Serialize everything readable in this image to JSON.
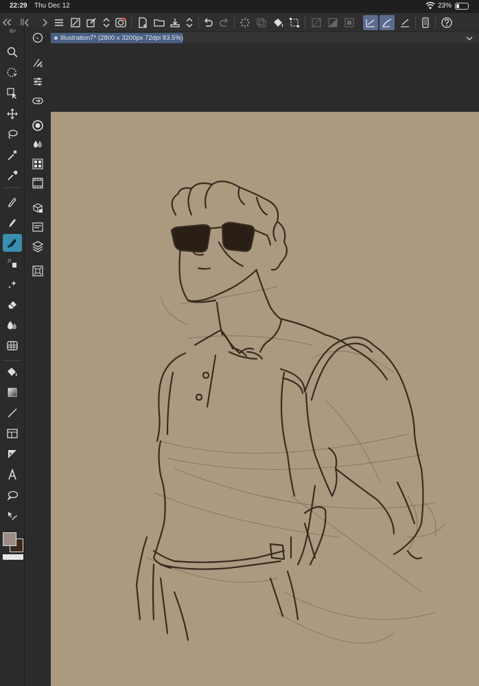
{
  "status_bar": {
    "time": "22:29",
    "date": "Thu Dec 12",
    "battery_percent": "23%"
  },
  "document": {
    "tab_title": "Illustration7* (2800 x 3200px 72dpi 83.5%)"
  },
  "colors": {
    "main_color": "#9c8d84",
    "sub_color": "#3a2a1e",
    "paper_color": "#ab9a80",
    "active_tool_accent": "#3a8fb0",
    "tab_accent": "#4a5f84"
  },
  "toolbar": {
    "tools": [
      "zoom-icon",
      "move-rotate-icon",
      "operation-icon",
      "move-layer-icon",
      "lasso-select-icon",
      "magic-wand-icon",
      "eyedropper-icon",
      "pen-icon",
      "pencil-icon",
      "brush-icon",
      "airbrush-icon",
      "decoration-icon",
      "eraser-icon",
      "blend-icon",
      "figure-icon",
      "fill-icon",
      "gradient-icon",
      "line-icon",
      "frame-icon",
      "ruler-icon",
      "text-icon",
      "balloon-icon",
      "correct-line-icon"
    ],
    "active_tool": "brush-icon"
  },
  "subtoolbar": {
    "items": [
      "navigator-icon",
      "brush-size-icon",
      "tool-property-icon",
      "sub-tool-icon",
      "color-wheel-icon",
      "color-set-icon",
      "layer-property-icon",
      "layer-search-icon",
      "material-icon",
      "animation-icon",
      "layer-icon",
      "history-icon"
    ]
  }
}
